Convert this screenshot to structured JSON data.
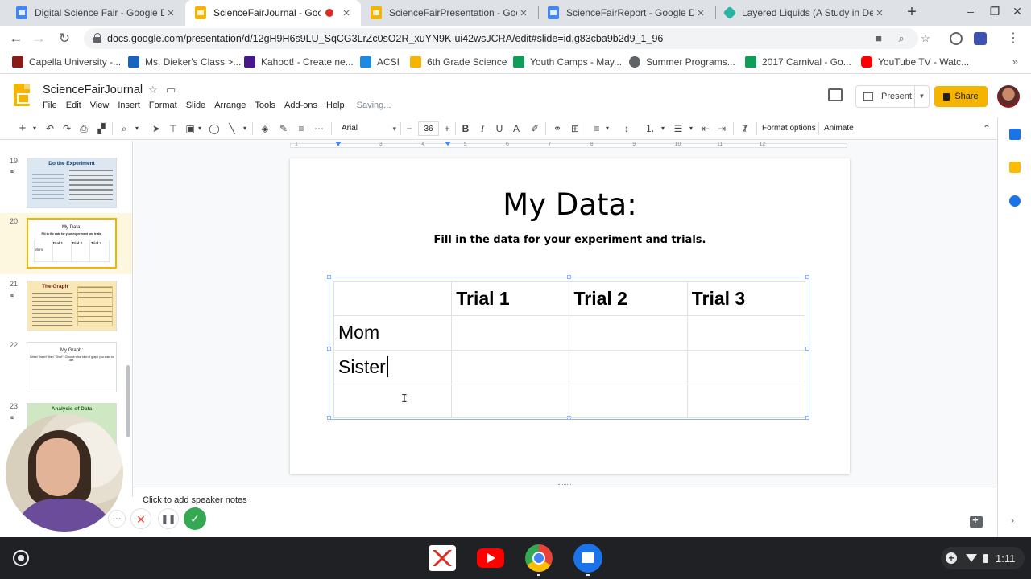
{
  "browser": {
    "tabs": [
      {
        "title": "Digital Science Fair - Google Docs",
        "icon": "docs-icon",
        "active": false
      },
      {
        "title": "ScienceFairJournal - Google Slides",
        "icon": "slides-icon",
        "active": true,
        "recording": true
      },
      {
        "title": "ScienceFairPresentation - Google Slides",
        "icon": "slides-icon",
        "active": false
      },
      {
        "title": "ScienceFairReport - Google Docs",
        "icon": "docs-icon",
        "active": false
      },
      {
        "title": "Layered Liquids (A Study in Density)",
        "icon": "drive-icon",
        "active": false
      }
    ],
    "url": "docs.google.com/presentation/d/12gH9H6s9LU_SqCG3LrZc0sO2R_xuYN9K-ui42wsJCRA/edit#slide=id.g83cba9b2d9_1_96",
    "bookmarks": [
      {
        "label": "Capella University -...",
        "color": "#8b1a1a"
      },
      {
        "label": "Ms. Dieker's Class >...",
        "color": "#1565c0"
      },
      {
        "label": "Kahoot! - Create ne...",
        "color": "#46178f"
      },
      {
        "label": "ACSI",
        "color": "#1e88e5"
      },
      {
        "label": "6th Grade Science",
        "color": "#f4b400"
      },
      {
        "label": "Youth Camps - May...",
        "color": "#0f9d58"
      },
      {
        "label": "Summer Programs...",
        "color": "#5f6368"
      },
      {
        "label": "2017 Carnival - Go...",
        "color": "#0f9d58"
      },
      {
        "label": "YouTube TV - Watc...",
        "color": "#ff0000"
      }
    ]
  },
  "app": {
    "doc_title": "ScienceFairJournal",
    "menu": [
      "File",
      "Edit",
      "View",
      "Insert",
      "Format",
      "Slide",
      "Arrange",
      "Tools",
      "Add-ons",
      "Help"
    ],
    "save_status": "Saving...",
    "present_label": "Present",
    "share_label": "Share"
  },
  "toolbar": {
    "font": "Arial",
    "font_size": "36",
    "format_options": "Format options",
    "animate": "Animate"
  },
  "filmstrip": {
    "slides": [
      {
        "num": "19",
        "title": "Do the Experiment",
        "style": "blue",
        "linked": true
      },
      {
        "num": "20",
        "title": "My Data:",
        "style": "white",
        "selected": true
      },
      {
        "num": "21",
        "title": "The Graph",
        "style": "cream",
        "linked": true
      },
      {
        "num": "22",
        "title": "My Graph:",
        "style": "white"
      },
      {
        "num": "23",
        "title": "Analysis of Data",
        "style": "green",
        "linked": true
      }
    ],
    "mini20": {
      "sub": "Fill in the data for your experiment and trials.",
      "cols": [
        "Trial 1",
        "Trial 2",
        "Trial 3"
      ],
      "row": "Mom"
    },
    "mini22": {
      "sub": "Select \"Insert\" then \"Chart\". Choose what kind of graph you want to use."
    }
  },
  "ruler": {
    "marks": [
      "1",
      "2",
      "3",
      "4",
      "5",
      "6",
      "7",
      "8",
      "9",
      "10",
      "11",
      "12"
    ]
  },
  "slide": {
    "title": "My Data:",
    "subtitle": "Fill in the data for your experiment and trials.",
    "table": {
      "header": [
        "",
        "Trial 1",
        "Trial 2",
        "Trial 3"
      ],
      "rows": [
        [
          "Mom",
          "",
          "",
          ""
        ],
        [
          "Sister",
          "",
          "",
          ""
        ],
        [
          "",
          "",
          "",
          ""
        ]
      ]
    }
  },
  "notes": {
    "placeholder": "Click to add speaker notes"
  },
  "shelf": {
    "time": "1:11"
  }
}
